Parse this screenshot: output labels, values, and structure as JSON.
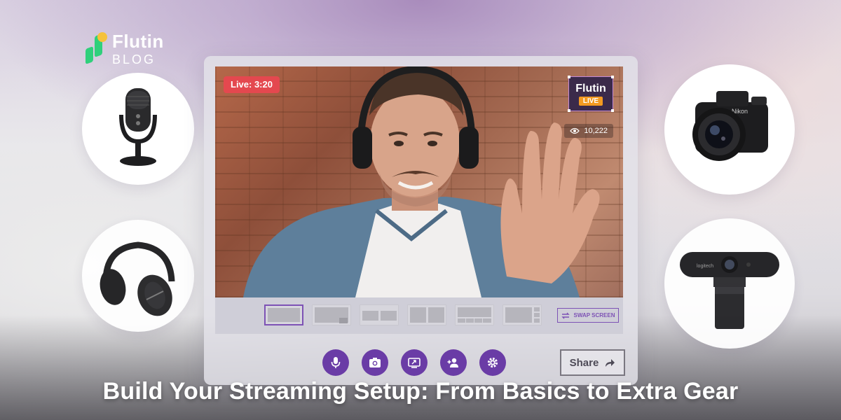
{
  "brand": {
    "name": "Flutin",
    "sub": "BLOG"
  },
  "stream": {
    "live_timer": "Live: 3:20",
    "overlay_name": "Flutin",
    "overlay_live": "LIVE",
    "viewer_count": "10,222"
  },
  "layout_bar": {
    "swap_label": "SWAP SCREEN"
  },
  "controls": {
    "icons": [
      "microphone-icon",
      "camera-icon",
      "screen-share-icon",
      "add-guest-icon",
      "settings-icon"
    ],
    "share_label": "Share"
  },
  "gear": [
    "microphone",
    "headphones",
    "dslr-camera",
    "webcam"
  ],
  "colors": {
    "accent": "#6a3ca6",
    "live_red": "#e4484f",
    "logo_green": "#2fd07b",
    "logo_yellow": "#f5c23a"
  },
  "headline": "Build Your Streaming Setup: From Basics to Extra Gear"
}
